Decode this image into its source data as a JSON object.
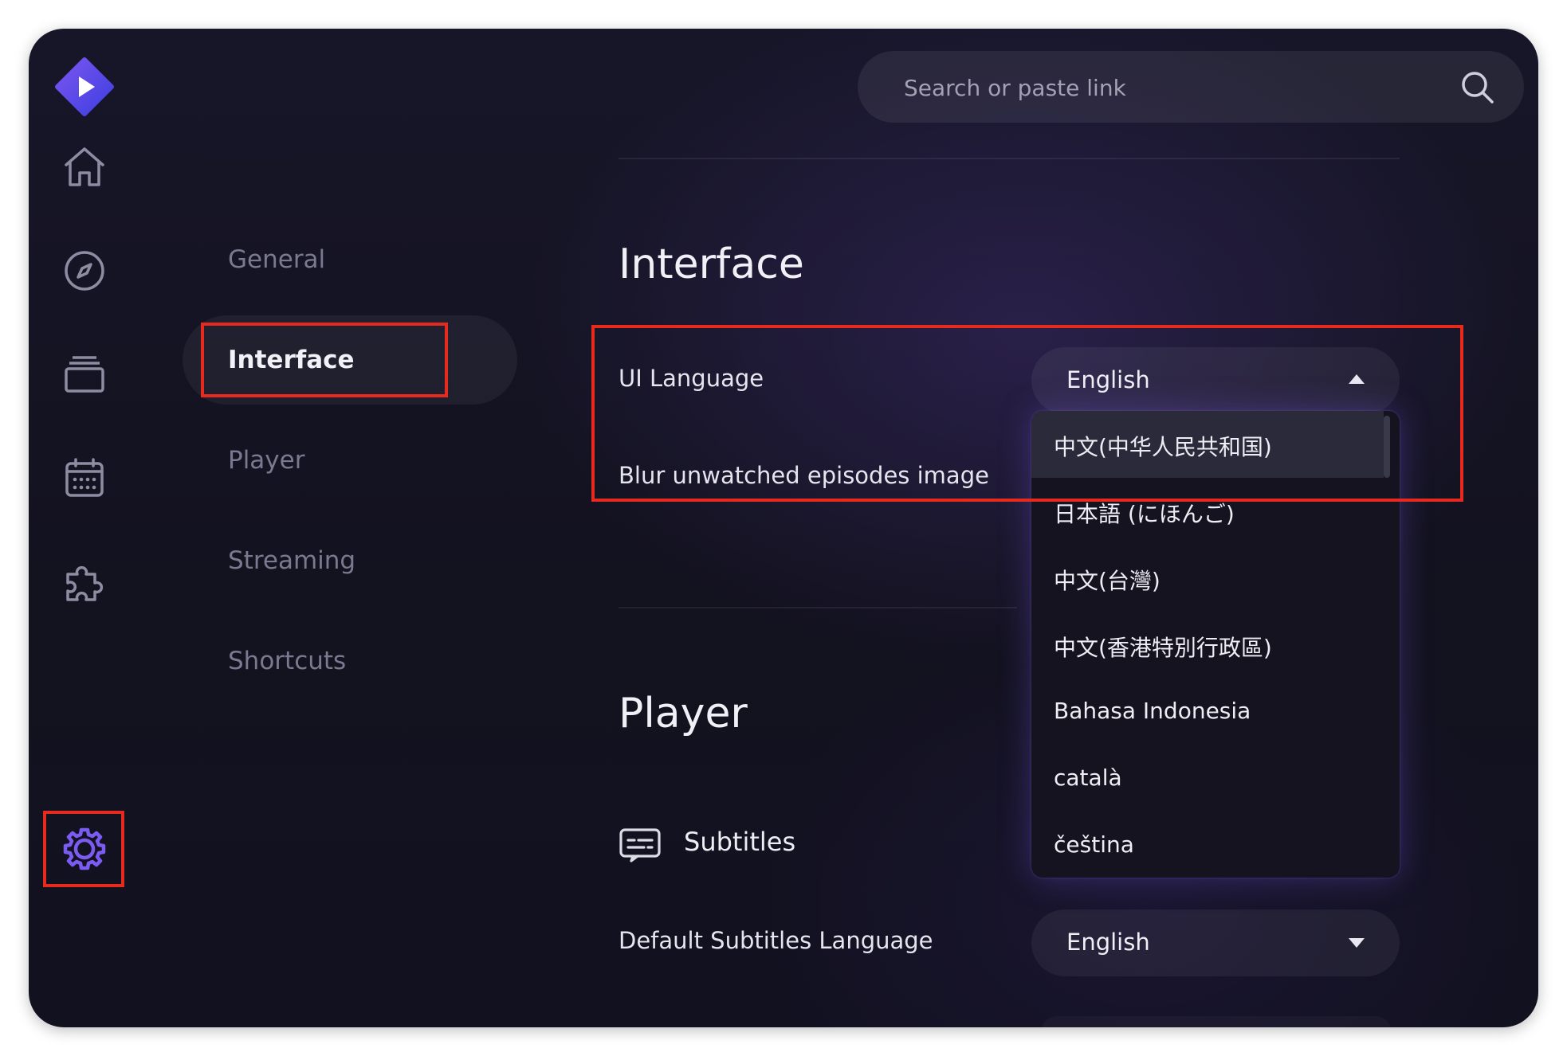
{
  "search": {
    "placeholder": "Search or paste link"
  },
  "nav": [
    {
      "name": "home-icon"
    },
    {
      "name": "compass-icon"
    },
    {
      "name": "library-icon"
    },
    {
      "name": "calendar-icon"
    },
    {
      "name": "puzzle-icon"
    },
    {
      "name": "settings-gear-icon"
    }
  ],
  "categories": [
    "General",
    "Interface",
    "Player",
    "Streaming",
    "Shortcuts"
  ],
  "active_category": "Interface",
  "interface": {
    "title": "Interface",
    "ui_language_label": "UI Language",
    "ui_language_value": "English",
    "blur_label": "Blur unwatched episodes image"
  },
  "language_menu": [
    "中文(中华人民共和国)",
    "日本語 (にほんご)",
    "中文(台灣)",
    "中文(香港特別行政區)",
    "Bahasa Indonesia",
    "català",
    "čeština"
  ],
  "player": {
    "title": "Player",
    "subtitles_heading": "Subtitles",
    "default_subtitles_label": "Default Subtitles Language",
    "default_subtitles_value": "English"
  },
  "colors": {
    "accent": "#6c52e6",
    "highlight_box": "#e62b1e"
  }
}
